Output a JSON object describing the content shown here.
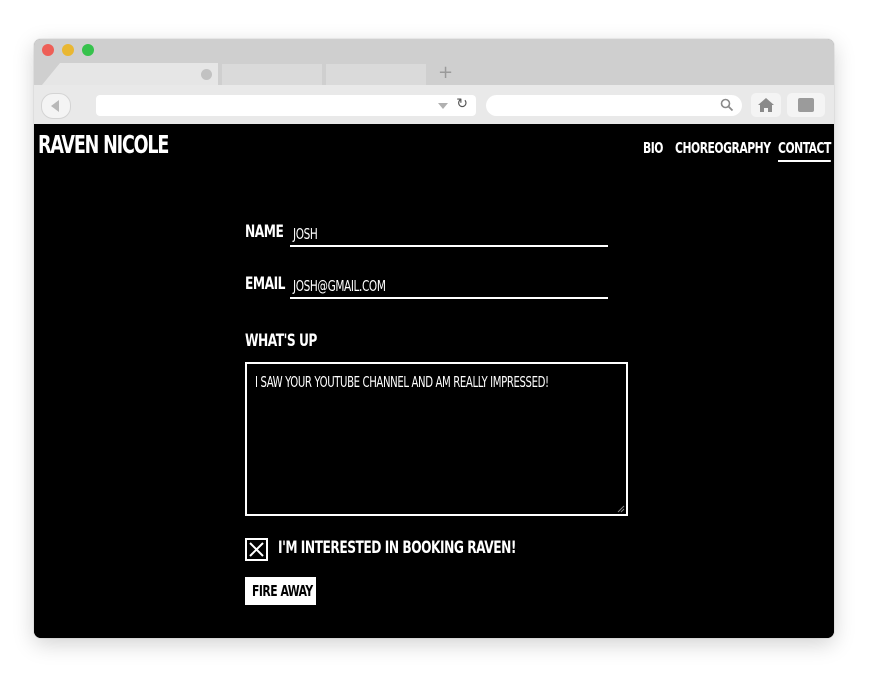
{
  "browser": {
    "icons": {
      "back": "back-arrow-icon",
      "dropdown": "chevron-down-icon",
      "reload": "reload-icon",
      "search": "search-icon",
      "home": "home-icon",
      "extension": "extension-icon",
      "new_tab": "plus-icon"
    },
    "new_tab_glyph": "+",
    "reload_glyph": "↻"
  },
  "site": {
    "logo": "RAVEN NICOLE",
    "nav": [
      {
        "label": "BIO",
        "active": false
      },
      {
        "label": "CHOREOGRAPHY",
        "active": false
      },
      {
        "label": "CONTACT",
        "active": true
      }
    ]
  },
  "form": {
    "name_label": "NAME",
    "name_value": "JOSH",
    "email_label": "EMAIL",
    "email_value": "JOSH@GMAIL.COM",
    "message_label": "WHAT'S UP",
    "message_value": "I SAW YOUR YOUTUBE CHANNEL AND AM REALLY IMPRESSED!",
    "booking_checked": true,
    "booking_label": "I'M INTERESTED IN BOOKING RAVEN!",
    "submit_label": "FIRE AWAY"
  },
  "colors": {
    "page_background": "#000000",
    "text": "#ffffff",
    "browser_chrome": "#d6d6d6"
  }
}
